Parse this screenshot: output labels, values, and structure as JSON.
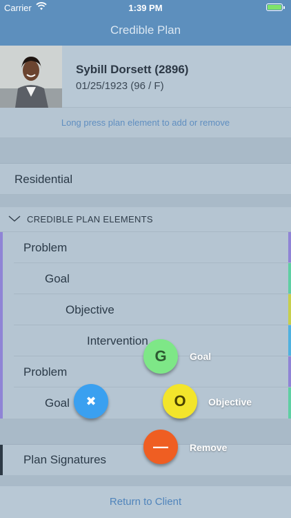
{
  "status_bar": {
    "carrier": "Carrier",
    "time": "1:39 PM"
  },
  "nav": {
    "title": "Credible Plan"
  },
  "client": {
    "name": "Sybill Dorsett (2896)",
    "dob": "01/25/1923 (96 / F)"
  },
  "hint": "Long press plan element to add or remove",
  "program": "Residential",
  "section": {
    "title": "CREDIBLE PLAN ELEMENTS"
  },
  "elements": [
    {
      "label": "Problem",
      "color": "#8f84d6"
    },
    {
      "label": "Goal",
      "color": "#5fcfa3"
    },
    {
      "label": "Objective",
      "color": "#c6cf4d"
    },
    {
      "label": "Intervention",
      "color": "#4fb1e0"
    },
    {
      "label": "Problem",
      "color": "#8f84d6"
    },
    {
      "label": "Goal",
      "color": "#5fcfa3"
    }
  ],
  "signatures": "Plan Signatures",
  "footer": {
    "return_label": "Return to Client"
  },
  "fab": {
    "goal": {
      "glyph": "G",
      "label": "Goal",
      "color": "#7ee787"
    },
    "objective": {
      "glyph": "O",
      "label": "Objective",
      "color": "#f3e52b"
    },
    "remove": {
      "glyph": "—",
      "label": "Remove",
      "color": "#ef5e22"
    },
    "close": {
      "glyph": "✖",
      "color": "#3aa0f0"
    }
  }
}
